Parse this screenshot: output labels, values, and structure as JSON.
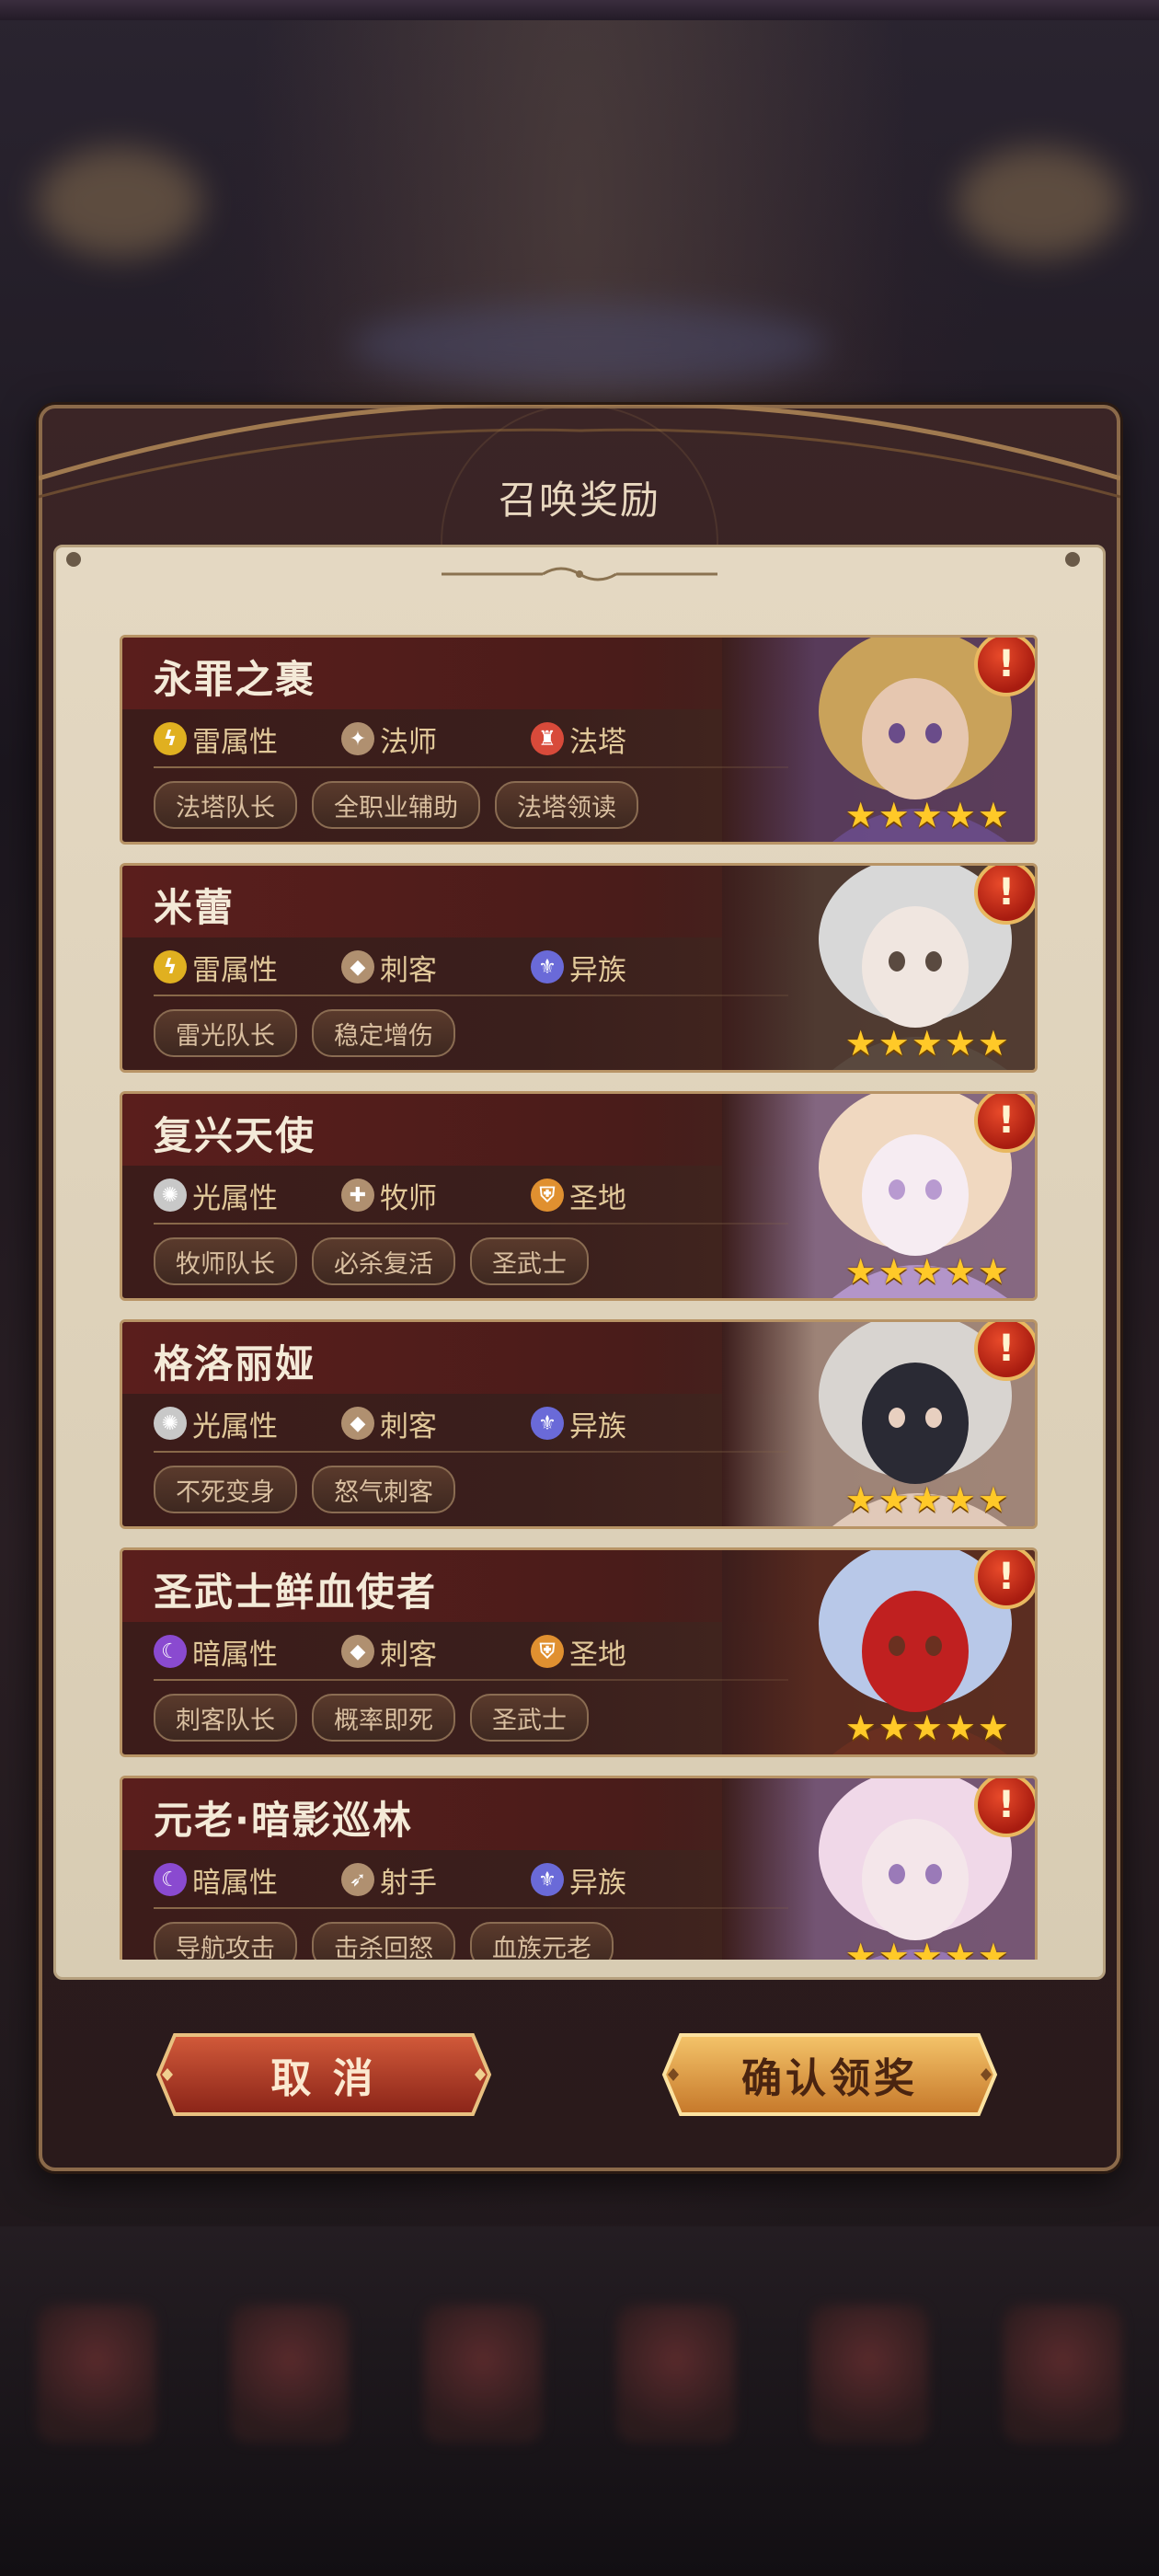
{
  "dialog": {
    "title": "召唤奖励"
  },
  "heroes": [
    {
      "name": "永罪之裹",
      "element": {
        "label": "雷属性",
        "icon": "lightning-icon",
        "color": "#e0b020"
      },
      "class": {
        "label": "法师",
        "icon": "mage-class-icon",
        "color": "#b09070"
      },
      "faction": {
        "label": "法塔",
        "icon": "tower-faction-icon",
        "color": "#d84a3a"
      },
      "tags": [
        "法塔队长",
        "全职业辅助",
        "法塔领读"
      ],
      "stars": 5,
      "portrait_colors": [
        "#c9a25a",
        "#e6c7b0",
        "#6a4c8a"
      ]
    },
    {
      "name": "米蕾",
      "element": {
        "label": "雷属性",
        "icon": "lightning-icon",
        "color": "#e0b020"
      },
      "class": {
        "label": "刺客",
        "icon": "assassin-class-icon",
        "color": "#b09070"
      },
      "faction": {
        "label": "异族",
        "icon": "otherworld-faction-icon",
        "color": "#6a6ad8"
      },
      "tags": [
        "雷光队长",
        "稳定增伤"
      ],
      "stars": 5,
      "portrait_colors": [
        "#d8d8d8",
        "#f0e6e0",
        "#5a4a40"
      ]
    },
    {
      "name": "复兴天使",
      "element": {
        "label": "光属性",
        "icon": "light-icon",
        "color": "#c8c8c8"
      },
      "class": {
        "label": "牧师",
        "icon": "priest-class-icon",
        "color": "#b09070"
      },
      "faction": {
        "label": "圣地",
        "icon": "holy-faction-icon",
        "color": "#e09030"
      },
      "tags": [
        "牧师队长",
        "必杀复活",
        "圣武士"
      ],
      "stars": 5,
      "portrait_colors": [
        "#f0d8c0",
        "#f6ecf2",
        "#b89ad0"
      ]
    },
    {
      "name": "格洛丽娅",
      "element": {
        "label": "光属性",
        "icon": "light-icon",
        "color": "#c8c8c8"
      },
      "class": {
        "label": "刺客",
        "icon": "assassin-class-icon",
        "color": "#b09070"
      },
      "faction": {
        "label": "异族",
        "icon": "otherworld-faction-icon",
        "color": "#6a6ad8"
      },
      "tags": [
        "不死变身",
        "怒气刺客"
      ],
      "stars": 5,
      "portrait_colors": [
        "#d8d4d0",
        "#2a2a34",
        "#e8d0c0"
      ]
    },
    {
      "name": "圣武士鲜血使者",
      "element": {
        "label": "暗属性",
        "icon": "dark-icon",
        "color": "#8a4ad0"
      },
      "class": {
        "label": "刺客",
        "icon": "assassin-class-icon",
        "color": "#b09070"
      },
      "faction": {
        "label": "圣地",
        "icon": "holy-faction-icon",
        "color": "#e09030"
      },
      "tags": [
        "刺客队长",
        "概率即死",
        "圣武士"
      ],
      "stars": 5,
      "portrait_colors": [
        "#b8c8e8",
        "#c02020",
        "#6a3020"
      ]
    },
    {
      "name": "元老·暗影巡林",
      "element": {
        "label": "暗属性",
        "icon": "dark-icon",
        "color": "#8a4ad0"
      },
      "class": {
        "label": "射手",
        "icon": "archer-class-icon",
        "color": "#b09070"
      },
      "faction": {
        "label": "异族",
        "icon": "otherworld-faction-icon",
        "color": "#6a6ad8"
      },
      "tags": [
        "导航攻击",
        "击杀回怒",
        "血族元老"
      ],
      "stars": 5,
      "portrait_colors": [
        "#f0d8e8",
        "#f4e6ea",
        "#9a7ab8"
      ]
    }
  ],
  "buttons": {
    "cancel": "取 消",
    "confirm": "确认领奖"
  },
  "icons": {
    "alert": "!",
    "star": "★"
  }
}
